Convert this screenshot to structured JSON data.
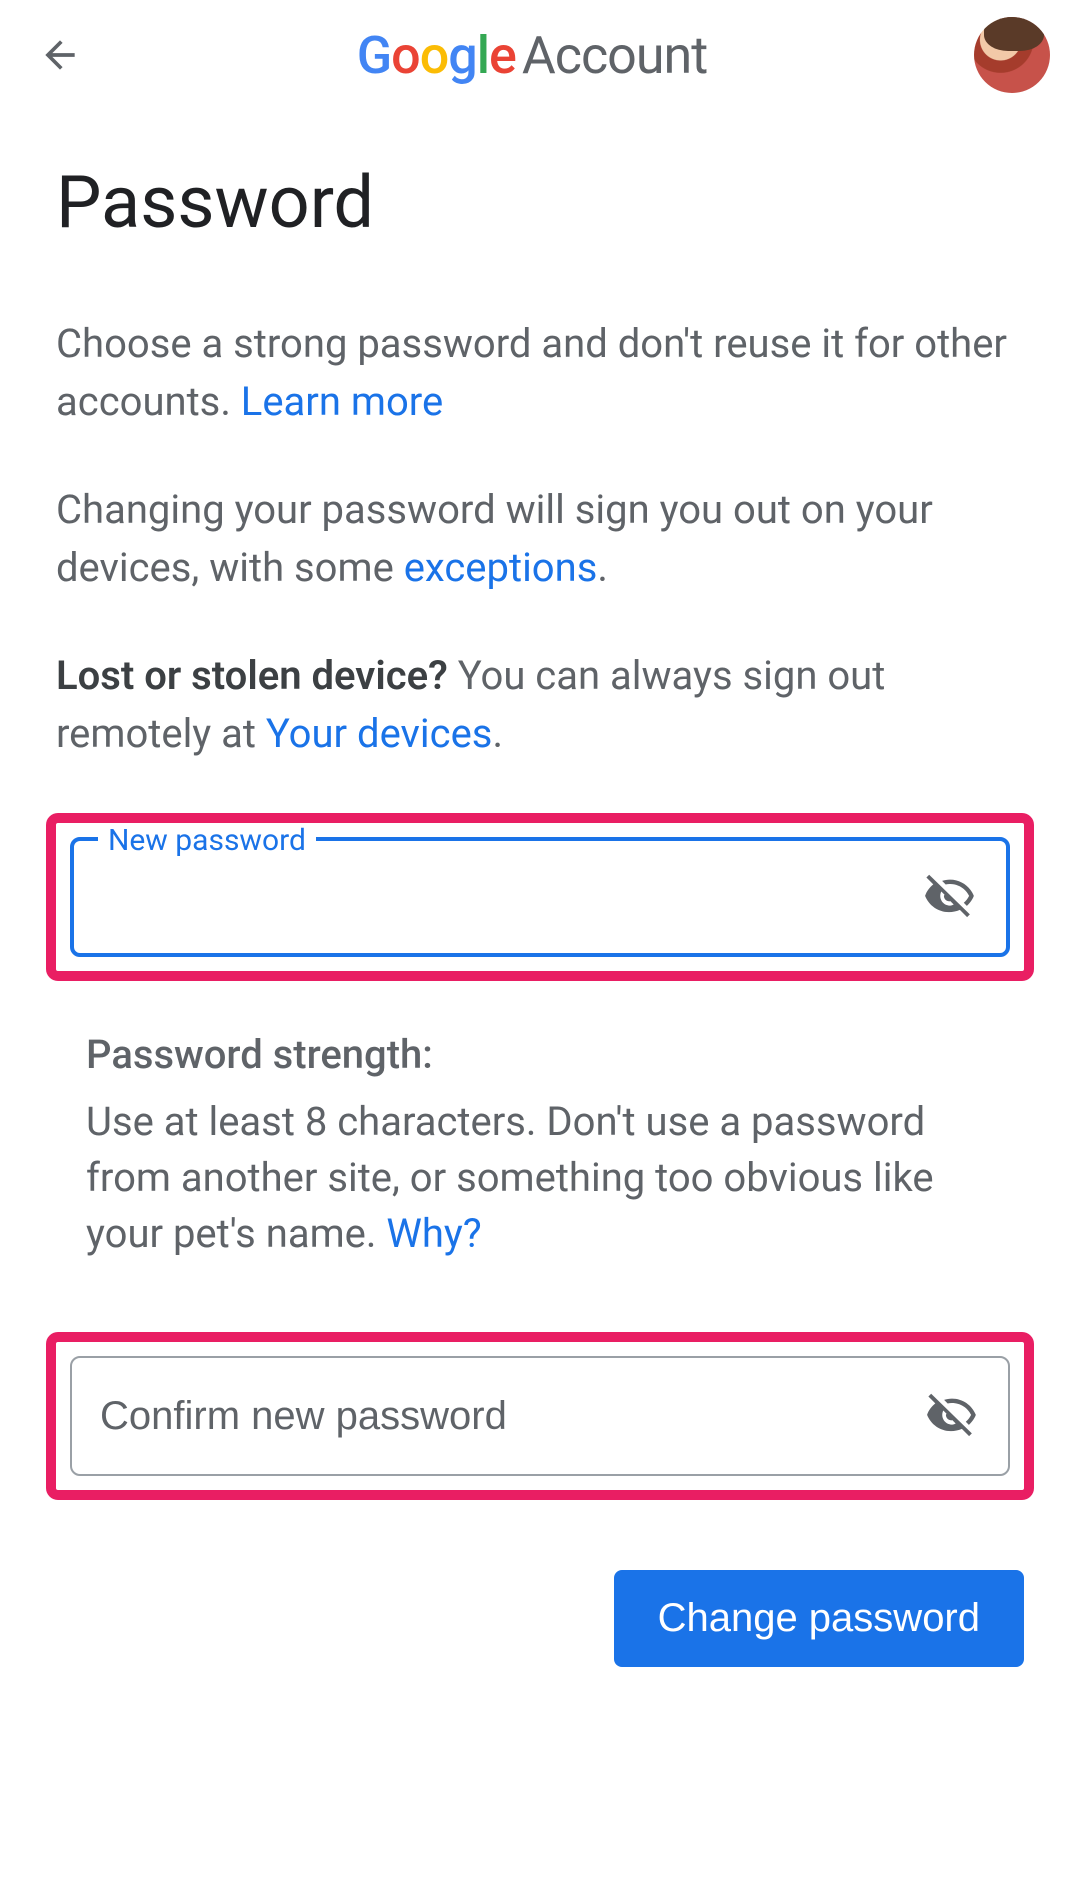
{
  "header": {
    "brand_g1": "G",
    "brand_o1": "o",
    "brand_o2": "o",
    "brand_g2": "g",
    "brand_l": "l",
    "brand_e": "e",
    "brand_account": "Account"
  },
  "page": {
    "title": "Password",
    "desc1_a": "Choose a strong password and don't reuse it for other accounts. ",
    "desc1_link": "Learn more",
    "desc2_a": "Changing your password will sign you out on your devices, with some ",
    "desc2_link": "exceptions",
    "desc2_b": ".",
    "desc3_bold": "Lost or stolen device? ",
    "desc3_a": "You can always sign out remotely at ",
    "desc3_link": "Your devices",
    "desc3_b": "."
  },
  "form": {
    "new_password_label": "New password",
    "new_password_value": "",
    "confirm_placeholder": "Confirm new password",
    "confirm_value": ""
  },
  "strength": {
    "title": "Password strength:",
    "body": "Use at least 8 characters. Don't use a password from another site, or something too obvious like your pet's name. ",
    "why": "Why?"
  },
  "actions": {
    "change": "Change password"
  },
  "colors": {
    "highlight": "#e91e63",
    "primary": "#1a73e8"
  }
}
